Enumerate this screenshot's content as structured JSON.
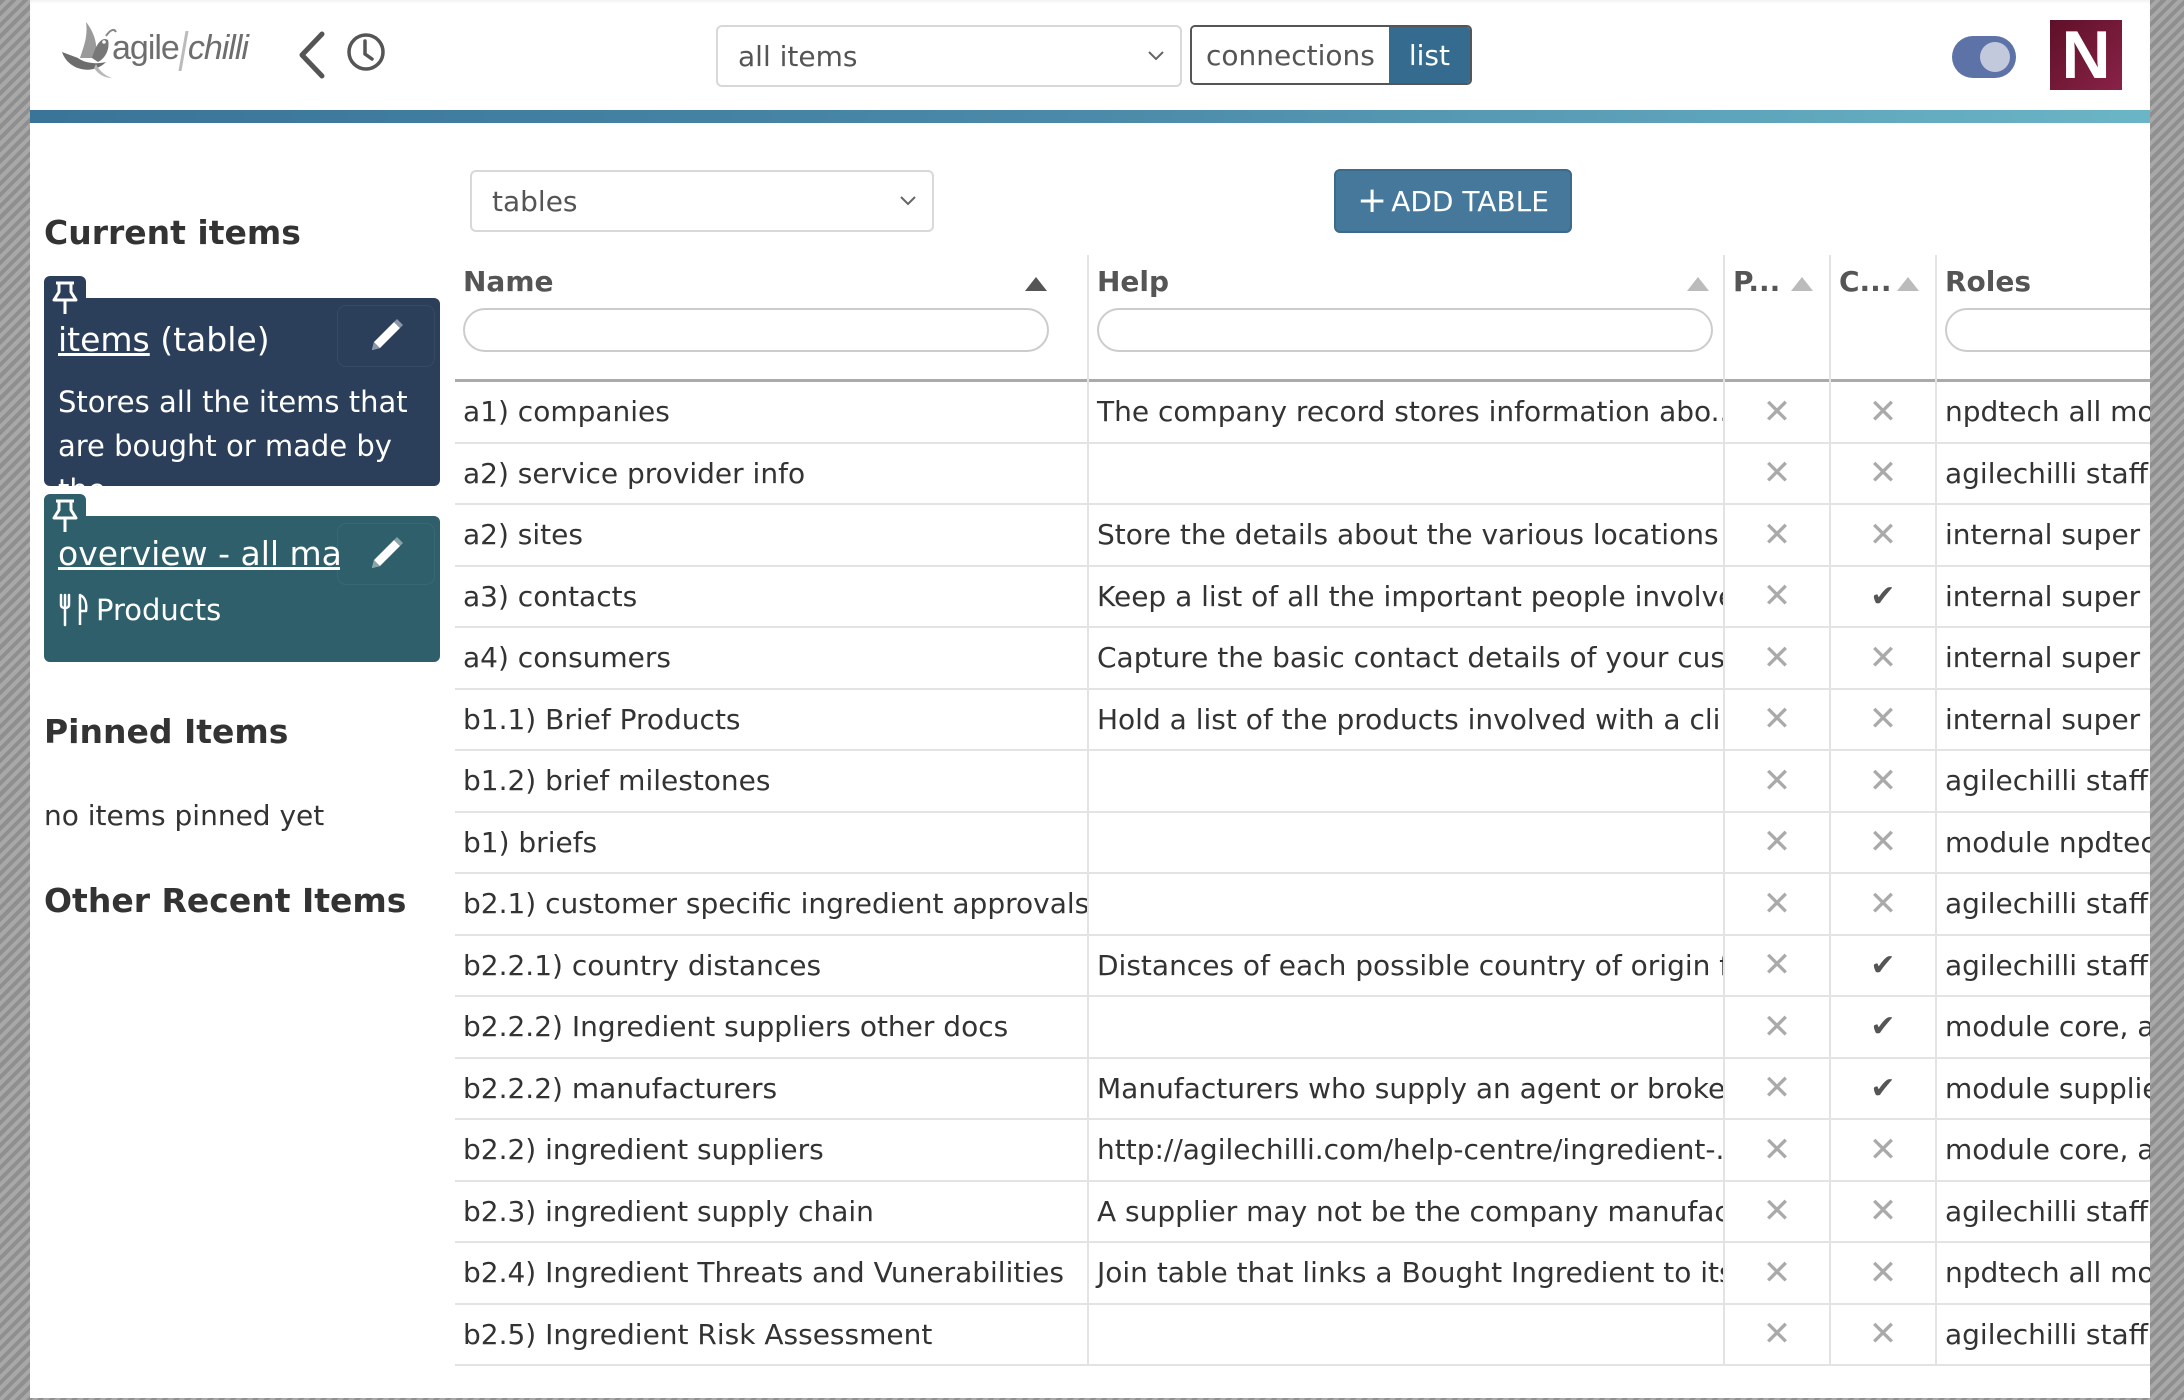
{
  "header": {
    "logo": {
      "text_left": "agile",
      "text_right": "chilli",
      "icon": "bird-logo-icon"
    },
    "back_icon": "chevron-left-icon",
    "history_icon": "clock-icon",
    "scope_select": {
      "value": "all items"
    },
    "view_toggle": {
      "options": [
        "connections",
        "list"
      ],
      "selected": "list"
    },
    "theme_switch": {
      "on": true
    },
    "brand_badge": "N",
    "colors": {
      "accent": "#356b8e",
      "switch": "#5d73a8",
      "brand": "#7a1a3c"
    }
  },
  "sidebar": {
    "current_heading": "Current items",
    "current_items": [
      {
        "link": "items",
        "suffix": " (table)",
        "description": "Stores all the items that are bought or made by the...",
        "pinned_icon": "pushpin-icon",
        "edit_icon": "pencil-icon",
        "color": "#2b3e5a"
      },
      {
        "link": "overview - all mac",
        "suffix": "",
        "description": "Products",
        "desc_icon": "utensils-icon",
        "pinned_icon": "pushpin-icon",
        "edit_icon": "pencil-icon",
        "color": "#2e5f6a"
      }
    ],
    "pinned_heading": "Pinned Items",
    "pinned_empty": "no items pinned yet",
    "recent_heading": "Other Recent Items"
  },
  "main": {
    "type_select": {
      "value": "tables"
    },
    "add_button": {
      "icon": "+",
      "label": "ADD TABLE"
    },
    "table": {
      "columns": [
        {
          "label": "Name",
          "sort": "asc-active",
          "filter_placeholder": ""
        },
        {
          "label": "Help",
          "sort": "asc",
          "filter_placeholder": ""
        },
        {
          "label": "P...",
          "sort": "asc"
        },
        {
          "label": "C...",
          "sort": "asc"
        },
        {
          "label": "Roles",
          "sort": "none",
          "filter_placeholder": ""
        }
      ],
      "rows": [
        {
          "name": "a1) companies",
          "help": "The company record stores information abo...",
          "p": false,
          "c": false,
          "roles": "npdtech all modul"
        },
        {
          "name": "a2) service provider info",
          "help": "",
          "p": false,
          "c": false,
          "roles": "agilechilli staff, int"
        },
        {
          "name": "a2) sites",
          "help": "Store the details about the various locations ...",
          "p": false,
          "c": false,
          "roles": "internal super use"
        },
        {
          "name": "a3) contacts",
          "help": "Keep a list of all the important people involve...",
          "p": false,
          "c": true,
          "roles": "internal super use"
        },
        {
          "name": "a4) consumers",
          "help": "Capture the basic contact details of your cust...",
          "p": false,
          "c": false,
          "roles": "internal super use"
        },
        {
          "name": "b1.1) Brief Products",
          "help": "Hold a list of the products involved with a cli...",
          "p": false,
          "c": false,
          "roles": "internal super use"
        },
        {
          "name": "b1.2) brief milestones",
          "help": "",
          "p": false,
          "c": false,
          "roles": "agilechilli staff, np"
        },
        {
          "name": "b1) briefs",
          "help": "",
          "p": false,
          "c": false,
          "roles": "module npdtech b"
        },
        {
          "name": "b2.1) customer specific ingredient approvals",
          "help": "",
          "p": false,
          "c": false,
          "roles": "agilechilli staff, mo"
        },
        {
          "name": "b2.2.1) country distances",
          "help": "Distances of each possible country of origin f...",
          "p": false,
          "c": true,
          "roles": "agilechilli staff, int"
        },
        {
          "name": "b2.2.2) Ingredient suppliers other docs",
          "help": "",
          "p": false,
          "c": true,
          "roles": "module core, agile"
        },
        {
          "name": "b2.2.2) manufacturers",
          "help": "Manufacturers who supply an agent or broke...",
          "p": false,
          "c": true,
          "roles": "module supplier a"
        },
        {
          "name": "b2.2) ingredient suppliers",
          "help": "http://agilechilli.com/help-centre/ingredient-...",
          "p": false,
          "c": false,
          "roles": "module core, agile"
        },
        {
          "name": "b2.3) ingredient supply chain",
          "help": "A supplier may not be the company manufac...",
          "p": false,
          "c": false,
          "roles": "agilechilli staff, np"
        },
        {
          "name": "b2.4) Ingredient Threats and Vunerabilities",
          "help": "Join table that links a Bought Ingredient to its...",
          "p": false,
          "c": false,
          "roles": "npdtech all modul"
        },
        {
          "name": "b2.5) Ingredient Risk Assessment",
          "help": "",
          "p": false,
          "c": false,
          "roles": "agilechilli staff, np"
        }
      ],
      "mark_glyphs": {
        "true": "✔",
        "false": "✕"
      }
    }
  }
}
